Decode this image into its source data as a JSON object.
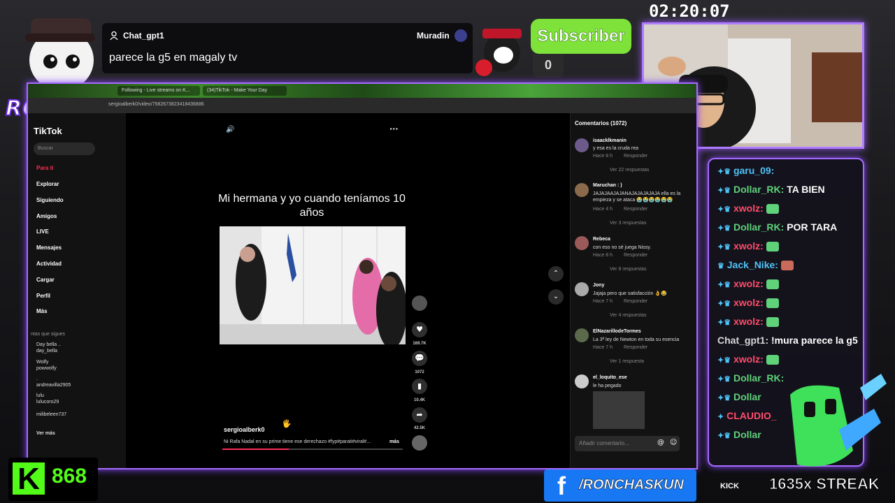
{
  "overlay": {
    "logo_text": "RONCHAS",
    "timer": "02:20:07",
    "message": {
      "user": "Chat_gpt1",
      "text": "parece la g5 en magaly tv",
      "author": "Muradin"
    },
    "subscriber": {
      "label": "Subscriber",
      "count": "0"
    },
    "kick": {
      "letter": "K",
      "count": "868"
    },
    "facebook": {
      "icon": "f",
      "handle": "/RONCHASKUN"
    },
    "socials_label": "KICK",
    "streak": "1635x STREAK"
  },
  "browser": {
    "tabs": [
      "Following - Live streams on K...",
      "(34)TikTok - Make Your Day"
    ],
    "url": "sergioalberk0/video/7582673823418436886"
  },
  "tiktok": {
    "logo": "TikTok",
    "search_placeholder": "Buscar",
    "nav": [
      "Para ti",
      "Explorar",
      "Siguiendo",
      "Amigos",
      "LIVE",
      "Mensajes",
      "Actividad",
      "Cargar",
      "Perfil",
      "Más"
    ],
    "following_header": "ntas que sigues",
    "following": [
      {
        "name": "Day bella ..",
        "handle": "day_bella"
      },
      {
        "name": "Wolfy",
        "handle": "powwolfy"
      },
      {
        "name": ".",
        "handle": "andreavilla2905"
      },
      {
        "name": "lulu",
        "handle": "lulucoro29"
      },
      {
        "name": "",
        "handle": "milibeleen737"
      }
    ],
    "see_more": "Ver más",
    "video": {
      "caption": "Mi hermana y yo cuando teníamos 10 años",
      "author": "sergioalberk0",
      "description": "Ni Rafa Nadal en su prime tiene ese derechazo #fyp#parati#viral#...",
      "more": "más",
      "likes": "169.7K",
      "comments": "1072",
      "saves": "10.4K",
      "shares": "42.5K",
      "progress": 0.37
    },
    "comments_title": "Comentarios (1072)",
    "comments": [
      {
        "name": "isaacklkmanin",
        "text": "y esa es la cruda rea",
        "time": "Hace 8 h",
        "reply": "Responder",
        "replies": "Ver 22 respuestas"
      },
      {
        "name": "Maruchan : )",
        "text": "JAJAJAAJAJANAJAJAJAJAJA ella es la empieza y se ataca 😭😭😭😭😭😭",
        "time": "Hace 4 h",
        "reply": "Responder",
        "replies": "Ver 3 respuestas"
      },
      {
        "name": "Rebeca",
        "text": "con eso no sé juega Nissy.",
        "time": "Hace 8 h",
        "reply": "Responder",
        "replies": "Ver 8 respuestas"
      },
      {
        "name": "Jony",
        "text": "Jajaja pero que satisfacción 👌😂",
        "time": "Hace 7 h",
        "reply": "Responder",
        "replies": "Ver 4 respuestas"
      },
      {
        "name": "ElNazarillodeTormes",
        "text": "La 3ª ley de Newton en toda su esencia",
        "time": "Hace 7 h",
        "reply": "Responder",
        "replies": "Ver 1 respuesta"
      },
      {
        "name": "el_loquito_ese",
        "text": "le ha pegado",
        "time": "",
        "reply": "",
        "replies": ""
      }
    ],
    "comment_placeholder": "Añadir comentario..."
  },
  "chat": [
    {
      "user": "garu_09:",
      "text": "",
      "color": "#4fc3f7"
    },
    {
      "user": "Dollar_RK:",
      "text": "TA BIEN",
      "color": "#5fd27a"
    },
    {
      "user": "xwolz:",
      "text": "",
      "color": "#ff4d6d"
    },
    {
      "user": "Dollar_RK:",
      "text": "POR TARA",
      "color": "#5fd27a"
    },
    {
      "user": "xwolz:",
      "text": "",
      "color": "#ff4d6d"
    },
    {
      "user": "Jack_Nike:",
      "text": "",
      "color": "#4fc3f7"
    },
    {
      "user": "xwolz:",
      "text": "",
      "color": "#ff4d6d"
    },
    {
      "user": "xwolz:",
      "text": "",
      "color": "#ff4d6d"
    },
    {
      "user": "xwolz:",
      "text": "",
      "color": "#ff4d6d"
    },
    {
      "user": "Chat_gpt1:",
      "text": "!mura parece la g5",
      "color": "#d8d8d8"
    },
    {
      "user": "xwolz:",
      "text": "",
      "color": "#ff4d6d"
    },
    {
      "user": "Dollar_RK:",
      "text": "",
      "color": "#5fd27a"
    },
    {
      "user": "Dollar",
      "text": "",
      "color": "#5fd27a"
    },
    {
      "user": "CLAUDIO_",
      "text": "",
      "color": "#ff4d6d"
    },
    {
      "user": "Dollar",
      "text": "",
      "color": "#5fd27a"
    }
  ]
}
